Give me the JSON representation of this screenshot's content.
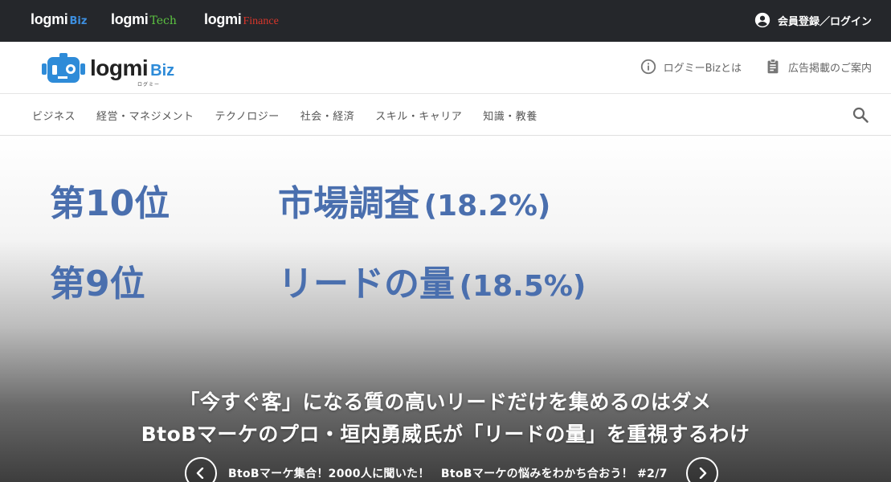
{
  "topbar": {
    "brands": [
      {
        "name": "logmi",
        "suffix": "Biz",
        "suffix_color": "#3d8fe0"
      },
      {
        "name": "logmi",
        "suffix": "Tech",
        "suffix_color": "#5cc341"
      },
      {
        "name": "logmi",
        "suffix": "Finance",
        "suffix_color": "#d9362b"
      }
    ],
    "login_label": "会員登録／ログイン"
  },
  "header": {
    "logo_word": "logmi",
    "logo_biz": "Biz",
    "logo_kana": "ログミー",
    "links": [
      {
        "icon": "info-icon",
        "label": "ログミーBizとは"
      },
      {
        "icon": "clipboard-icon",
        "label": "広告掲載のご案内"
      }
    ]
  },
  "categories": [
    "ビジネス",
    "経営・マネジメント",
    "テクノロジー",
    "社会・経済",
    "スキル・キャリア",
    "知識・教養"
  ],
  "hero": {
    "slide_rows": [
      {
        "rank": "第10位",
        "item": "市場調査",
        "pct": "(18.2%)"
      },
      {
        "rank": "第9位",
        "item": "リードの量",
        "pct": "(18.5%)"
      }
    ],
    "title_line1": "「今すぐ客」になる質の高いリードだけを集めるのはダメ",
    "title_line2": "BtoBマーケのプロ・垣内勇威氏が「リードの量」を重視するわけ",
    "series_text": "BtoBマーケ集合！2000人に聞いた！　BtoBマーケの悩みをわかち合おう！ #2/7"
  }
}
